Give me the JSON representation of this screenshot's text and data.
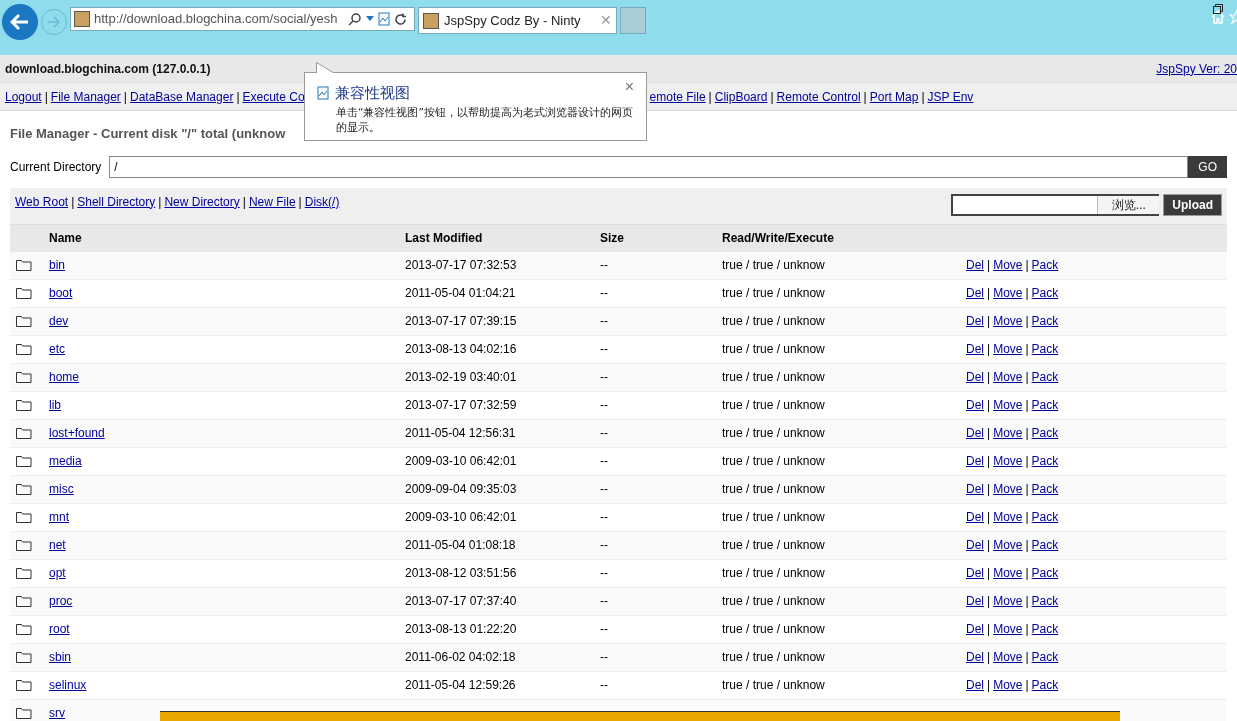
{
  "browser": {
    "address": "http://download.blogchina.com/social/yesh",
    "tab_title": "JspSpy Codz By - Ninty",
    "tab_close": "✕"
  },
  "separator": "|",
  "header": {
    "host": "download.blogchina.com (127.0.0.1)",
    "version": "JspSpy Ver: 20"
  },
  "nav_left": [
    "Logout",
    "File Manager",
    "DataBase Manager",
    "Execute Co"
  ],
  "nav_right": [
    "emote File",
    "ClipBoard",
    "Remote Control",
    "Port Map",
    "JSP Env"
  ],
  "popup": {
    "title": "兼容性视图",
    "text": "单击“兼容性视图”按钮，以帮助提高为老式浏览器设计的网页的显示。",
    "close": "×"
  },
  "page_title": "File Manager - Current disk \"/\" total (unknow",
  "directory": {
    "label": "Current Directory",
    "value": "/",
    "button": "GO"
  },
  "toolbar_links": [
    "Web Root",
    "Shell Directory",
    "New Directory",
    "New File",
    "Disk(/)"
  ],
  "upload": {
    "browse": "浏览...",
    "button": "Upload"
  },
  "table": {
    "columns": [
      "Name",
      "Last Modified",
      "Size",
      "Read/Write/Execute"
    ],
    "rows": [
      {
        "name": "bin",
        "modified": "2013-07-17 07:32:53",
        "size": "--",
        "rwx": "true / true / unknow",
        "actions": [
          "Del",
          "Move",
          "Pack"
        ]
      },
      {
        "name": "boot",
        "modified": "2011-05-04 01:04:21",
        "size": "--",
        "rwx": "true / true / unknow",
        "actions": [
          "Del",
          "Move",
          "Pack"
        ]
      },
      {
        "name": "dev",
        "modified": "2013-07-17 07:39:15",
        "size": "--",
        "rwx": "true / true / unknow",
        "actions": [
          "Del",
          "Move",
          "Pack"
        ]
      },
      {
        "name": "etc",
        "modified": "2013-08-13 04:02:16",
        "size": "--",
        "rwx": "true / true / unknow",
        "actions": [
          "Del",
          "Move",
          "Pack"
        ]
      },
      {
        "name": "home",
        "modified": "2013-02-19 03:40:01",
        "size": "--",
        "rwx": "true / true / unknow",
        "actions": [
          "Del",
          "Move",
          "Pack"
        ]
      },
      {
        "name": "lib",
        "modified": "2013-07-17 07:32:59",
        "size": "--",
        "rwx": "true / true / unknow",
        "actions": [
          "Del",
          "Move",
          "Pack"
        ]
      },
      {
        "name": "lost+found",
        "modified": "2011-05-04 12:56:31",
        "size": "--",
        "rwx": "true / true / unknow",
        "actions": [
          "Del",
          "Move",
          "Pack"
        ]
      },
      {
        "name": "media",
        "modified": "2009-03-10 06:42:01",
        "size": "--",
        "rwx": "true / true / unknow",
        "actions": [
          "Del",
          "Move",
          "Pack"
        ]
      },
      {
        "name": "misc",
        "modified": "2009-09-04 09:35:03",
        "size": "--",
        "rwx": "true / true / unknow",
        "actions": [
          "Del",
          "Move",
          "Pack"
        ]
      },
      {
        "name": "mnt",
        "modified": "2009-03-10 06:42:01",
        "size": "--",
        "rwx": "true / true / unknow",
        "actions": [
          "Del",
          "Move",
          "Pack"
        ]
      },
      {
        "name": "net",
        "modified": "2011-05-04 01:08:18",
        "size": "--",
        "rwx": "true / true / unknow",
        "actions": [
          "Del",
          "Move",
          "Pack"
        ]
      },
      {
        "name": "opt",
        "modified": "2013-08-12 03:51:56",
        "size": "--",
        "rwx": "true / true / unknow",
        "actions": [
          "Del",
          "Move",
          "Pack"
        ]
      },
      {
        "name": "proc",
        "modified": "2013-07-17 07:37:40",
        "size": "--",
        "rwx": "true / true / unknow",
        "actions": [
          "Del",
          "Move",
          "Pack"
        ]
      },
      {
        "name": "root",
        "modified": "2013-08-13 01:22:20",
        "size": "--",
        "rwx": "true / true / unknow",
        "actions": [
          "Del",
          "Move",
          "Pack"
        ]
      },
      {
        "name": "sbin",
        "modified": "2011-06-02 04:02:18",
        "size": "--",
        "rwx": "true / true / unknow",
        "actions": [
          "Del",
          "Move",
          "Pack"
        ]
      },
      {
        "name": "selinux",
        "modified": "2011-05-04 12:59:26",
        "size": "--",
        "rwx": "true / true / unknow",
        "actions": [
          "Del",
          "Move",
          "Pack"
        ]
      },
      {
        "name": "srv"
      }
    ]
  }
}
